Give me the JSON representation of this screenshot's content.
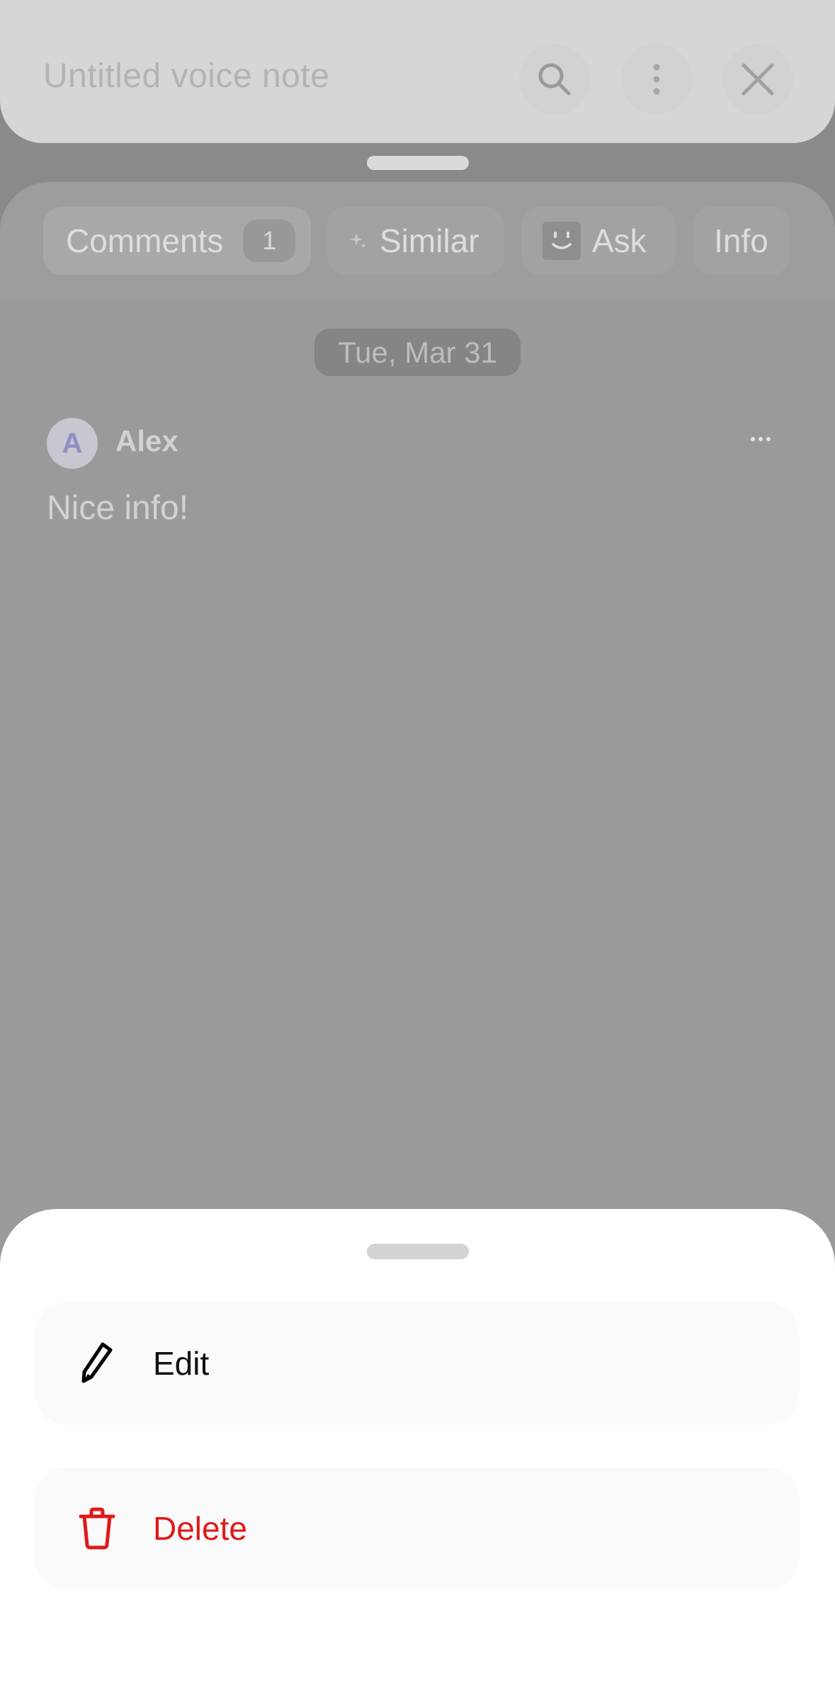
{
  "header": {
    "title": "Untitled voice note",
    "icons": {
      "search": "search-icon",
      "more": "more-vertical-icon",
      "close": "close-icon"
    }
  },
  "tabs": [
    {
      "label": "Comments",
      "count": "1"
    },
    {
      "label": "Similar",
      "icon": "sparkle-icon"
    },
    {
      "label": "Ask",
      "icon": "smiley-face-icon"
    },
    {
      "label": "Info"
    }
  ],
  "comments": {
    "date": "Tue, Mar 31",
    "items": [
      {
        "avatar_initial": "A",
        "author": "Alex",
        "text": "Nice info!"
      }
    ]
  },
  "action_sheet": {
    "edit_label": "Edit",
    "delete_label": "Delete"
  },
  "colors": {
    "delete": "#e01919",
    "avatar_letter": "#8f8fc4",
    "overlay": "#9a9a9a"
  }
}
